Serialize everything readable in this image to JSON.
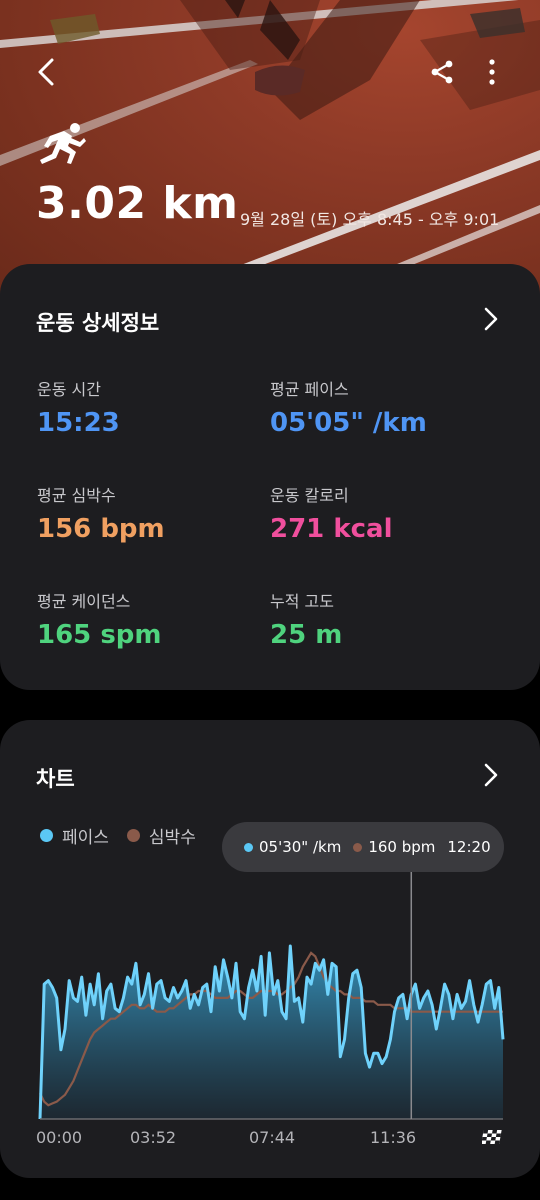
{
  "hero": {
    "distance": "3.02 km",
    "datetime": "9월 28일 (토) 오후 8:45 - 오후 9:01"
  },
  "details": {
    "title": "운동 상세정보",
    "metrics": [
      {
        "label": "운동 시간",
        "value": "15:23",
        "color": "#4f95f4"
      },
      {
        "label": "평균 페이스",
        "value": "05'05\" /km",
        "color": "#4f95f4"
      },
      {
        "label": "평균 심박수",
        "value": "156 bpm",
        "color": "#f0a061"
      },
      {
        "label": "운동 칼로리",
        "value": "271 kcal",
        "color": "#f04f9d"
      },
      {
        "label": "평균 케이던스",
        "value": "165 spm",
        "color": "#4fd37e"
      },
      {
        "label": "누적 고도",
        "value": "25 m",
        "color": "#4fd37e"
      }
    ]
  },
  "chart_card": {
    "title": "차트",
    "legend": [
      {
        "name": "페이스",
        "color": "#5bc8f5"
      },
      {
        "name": "심박수",
        "color": "#8a5a4a"
      }
    ],
    "tooltip": {
      "pace": "05'30\" /km",
      "heart_rate": "160 bpm",
      "time": "12:20"
    },
    "x_ticks": [
      "00:00",
      "03:52",
      "07:44",
      "11:36"
    ]
  },
  "chart_data": {
    "type": "area",
    "x_unit": "minutes",
    "x_range": [
      0,
      15.38
    ],
    "series": [
      {
        "name": "페이스",
        "color": "#5bc8f5",
        "values": [
          0,
          78,
          80,
          76,
          70,
          40,
          52,
          80,
          70,
          68,
          82,
          60,
          78,
          66,
          84,
          58,
          74,
          78,
          64,
          62,
          70,
          82,
          78,
          90,
          66,
          72,
          84,
          64,
          78,
          80,
          70,
          68,
          76,
          70,
          74,
          80,
          64,
          72,
          66,
          76,
          78,
          62,
          88,
          74,
          92,
          82,
          70,
          90,
          62,
          58,
          76,
          86,
          74,
          94,
          60,
          96,
          72,
          80,
          62,
          58,
          100,
          68,
          70,
          56,
          82,
          78,
          90,
          86,
          92,
          72,
          90,
          88,
          36,
          46,
          70,
          84,
          86,
          76,
          38,
          30,
          38,
          38,
          32,
          36,
          46,
          62,
          70,
          72,
          58,
          72,
          78,
          64,
          70,
          74,
          66,
          52,
          64,
          78,
          72,
          58,
          72,
          64,
          68,
          80,
          66,
          56,
          66,
          78,
          80,
          64,
          76,
          46
        ]
      },
      {
        "name": "심박수",
        "color": "#8a5a4a",
        "values": [
          15,
          10,
          8,
          9,
          10,
          12,
          14,
          18,
          22,
          28,
          34,
          40,
          46,
          50,
          52,
          54,
          56,
          58,
          58,
          60,
          62,
          64,
          66,
          66,
          64,
          64,
          66,
          64,
          62,
          62,
          62,
          64,
          64,
          66,
          68,
          70,
          72,
          72,
          74,
          74,
          74,
          72,
          70,
          70,
          70,
          70,
          72,
          74,
          74,
          72,
          70,
          70,
          72,
          74,
          74,
          74,
          74,
          72,
          72,
          74,
          76,
          78,
          82,
          88,
          92,
          96,
          94,
          88,
          82,
          78,
          76,
          74,
          74,
          72,
          72,
          70,
          70,
          70,
          68,
          68,
          68,
          66,
          66,
          66,
          66,
          64,
          64,
          64,
          64,
          62,
          62,
          62,
          62,
          62,
          62,
          62,
          62,
          62,
          62,
          62,
          62,
          62,
          62,
          62,
          62,
          62,
          62,
          62,
          62,
          62,
          62,
          62
        ]
      }
    ],
    "cursor_time": "12:20"
  }
}
